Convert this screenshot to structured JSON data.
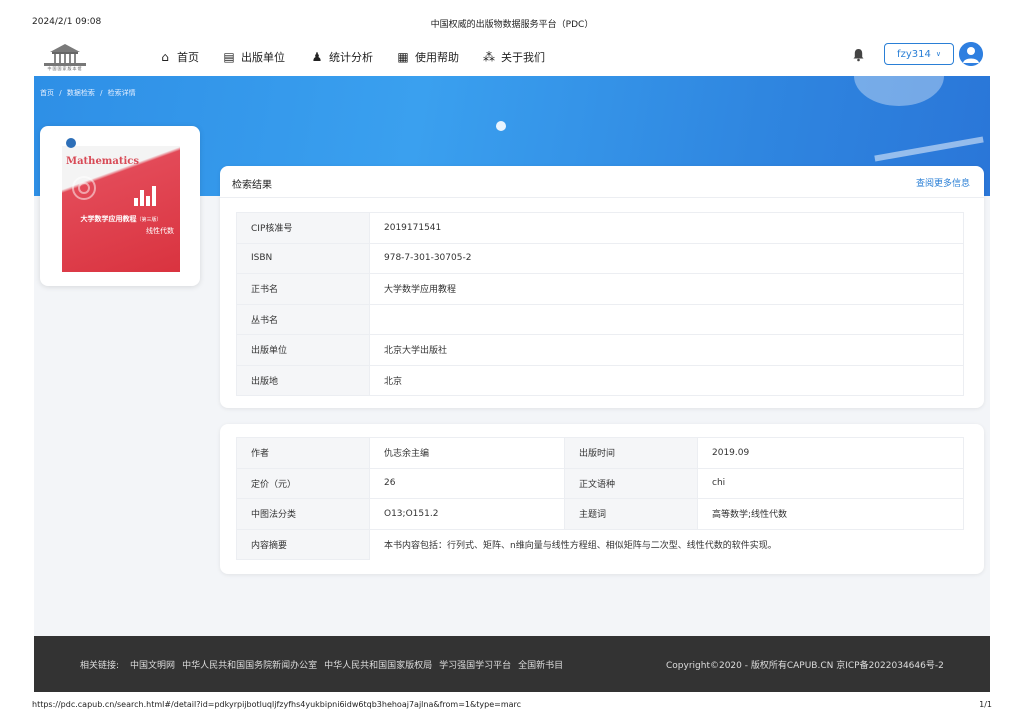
{
  "print_header": {
    "datetime": "2024/2/1 09:08",
    "title": "中国权威的出版物数据服务平台（PDC）"
  },
  "nav": {
    "items": [
      {
        "label": "首页",
        "icon": "home-icon"
      },
      {
        "label": "出版单位",
        "icon": "book-icon"
      },
      {
        "label": "统计分析",
        "icon": "users-icon"
      },
      {
        "label": "使用帮助",
        "icon": "help-doc-icon"
      },
      {
        "label": "关于我们",
        "icon": "about-icon"
      }
    ],
    "username": "fzy314",
    "logo_caption": "中国国家版本馆"
  },
  "breadcrumb": {
    "items": [
      "首页",
      "数据检索",
      "检索详情"
    ],
    "separator": "/"
  },
  "book_cover": {
    "heading": "Mathematics",
    "title": "大学数学应用教程",
    "edition": "（第三版）",
    "subtitle": "线性代数"
  },
  "result_panel": {
    "title": "检索结果",
    "more_link": "查阅更多信息",
    "rows": [
      {
        "key": "CIP核准号",
        "value": "2019171541"
      },
      {
        "key": "ISBN",
        "value": "978-7-301-30705-2"
      },
      {
        "key": "正书名",
        "value": "大学数学应用教程"
      },
      {
        "key": "丛书名",
        "value": ""
      },
      {
        "key": "出版单位",
        "value": "北京大学出版社"
      },
      {
        "key": "出版地",
        "value": "北京"
      }
    ]
  },
  "detail_panel": {
    "author_key": "作者",
    "author": "仇志余主编",
    "date_key": "出版时间",
    "date": "2019.09",
    "price_key": "定价（元）",
    "price": "26",
    "lang_key": "正文语种",
    "lang": "chi",
    "class_key": "中图法分类",
    "class": "O13;O151.2",
    "subject_key": "主题词",
    "subject": "高等数学;线性代数",
    "summary_key": "内容摘要",
    "summary": "本书内容包括：行列式、矩阵、n维向量与线性方程组、相似矩阵与二次型、线性代数的软件实现。"
  },
  "footer": {
    "links_label": "相关链接:",
    "links": [
      "中国文明网",
      "中华人民共和国国务院新闻办公室",
      "中华人民共和国国家版权局",
      "学习强国学习平台",
      "全国新书目"
    ],
    "copyright": "Copyright©2020 - 版权所有CAPUB.CN 京ICP备2022034646号-2"
  },
  "print_footer": {
    "url": "https://pdc.capub.cn/search.html#/detail?id=pdkyrpijbotluqljfzyfhs4yukbipni6idw6tqb3hehoaj7ajlna&from=1&type=marc",
    "page": "1/1"
  },
  "colors": {
    "accent": "#2a7fd6",
    "hero": "#3a9bee",
    "footer_bg": "#333333",
    "key_cell_bg": "#f5f6f8"
  }
}
